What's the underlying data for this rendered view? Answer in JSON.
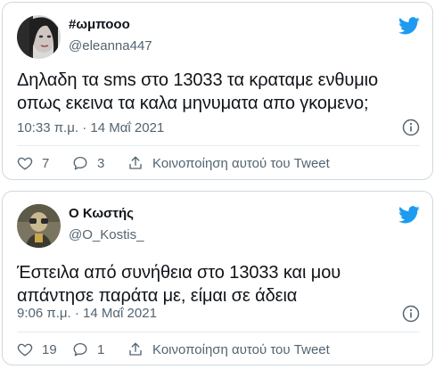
{
  "colors": {
    "accent": "#1d9bf0",
    "secondary_text": "#536471",
    "border": "#cfd9de"
  },
  "tweets": [
    {
      "display_name": "#ωμποοο",
      "handle": "@eleanna447",
      "text": "Δηλαδη τα sms στο 13033 τα κραταμε ενθυμιο οπως εκεινα τα καλα μηνυματα απο γκομενο;",
      "timestamp": "10:33 π.μ. · 14 Μαΐ 2021",
      "likes": "7",
      "replies": "3",
      "share_label": "Κοινοποίηση αυτού του Tweet",
      "icons": {
        "logo": "twitter-bird-icon",
        "info": "info-icon",
        "like": "heart-icon",
        "reply": "reply-bubble-icon",
        "share": "share-icon"
      }
    },
    {
      "display_name": "Ο Κωστής",
      "handle": "@O_Kostis_",
      "text": "Έστειλα από συνήθεια στο 13033 και μου απάντησε παράτα με, είμαι σε άδεια",
      "timestamp": "9:06 π.μ. · 14 Μαΐ 2021",
      "likes": "19",
      "replies": "1",
      "share_label": "Κοινοποίηση αυτού του Tweet",
      "icons": {
        "logo": "twitter-bird-icon",
        "info": "info-icon",
        "like": "heart-icon",
        "reply": "reply-bubble-icon",
        "share": "share-icon"
      }
    }
  ]
}
